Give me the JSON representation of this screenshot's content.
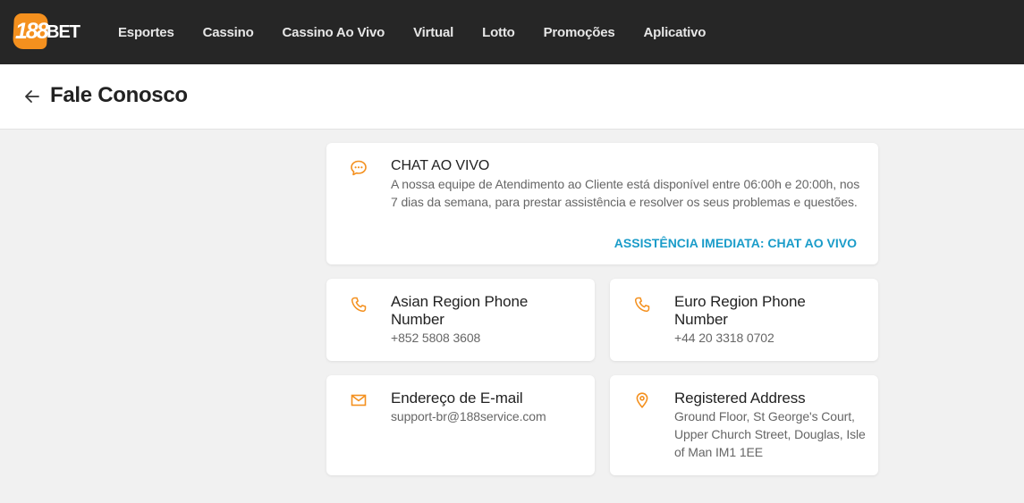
{
  "brand": {
    "logo_number": "188",
    "logo_word": "BET",
    "accent_color": "#f4901e"
  },
  "nav": {
    "items": [
      "Esportes",
      "Cassino",
      "Cassino Ao Vivo",
      "Virtual",
      "Lotto",
      "Promoções",
      "Aplicativo"
    ]
  },
  "header": {
    "back_icon": "arrow-left-icon",
    "title": "Fale Conosco"
  },
  "contacts": {
    "chat": {
      "icon": "chat-bubble-icon",
      "title": "CHAT AO VIVO",
      "description": "A nossa equipe de Atendimento ao Cliente está disponível entre 06:00h e 20:00h, nos 7 dias da semana, para prestar assistência e resolver os seus problemas e questões.",
      "cta": "ASSISTÊNCIA IMEDIATA: CHAT AO VIVO",
      "cta_color": "#1a9cc9"
    },
    "asia_phone": {
      "icon": "phone-icon",
      "title": "Asian Region Phone Number",
      "value": "+852 5808 3608"
    },
    "euro_phone": {
      "icon": "phone-icon",
      "title": "Euro Region Phone Number",
      "value": "+44 20 3318 0702"
    },
    "email": {
      "icon": "mail-icon",
      "title": "Endereço de E-mail",
      "value": "support-br@188service.com"
    },
    "address": {
      "icon": "location-pin-icon",
      "title": "Registered Address",
      "value": "Ground Floor, St George's Court, Upper Church Street, Douglas, Isle of Man IM1 1EE"
    }
  }
}
